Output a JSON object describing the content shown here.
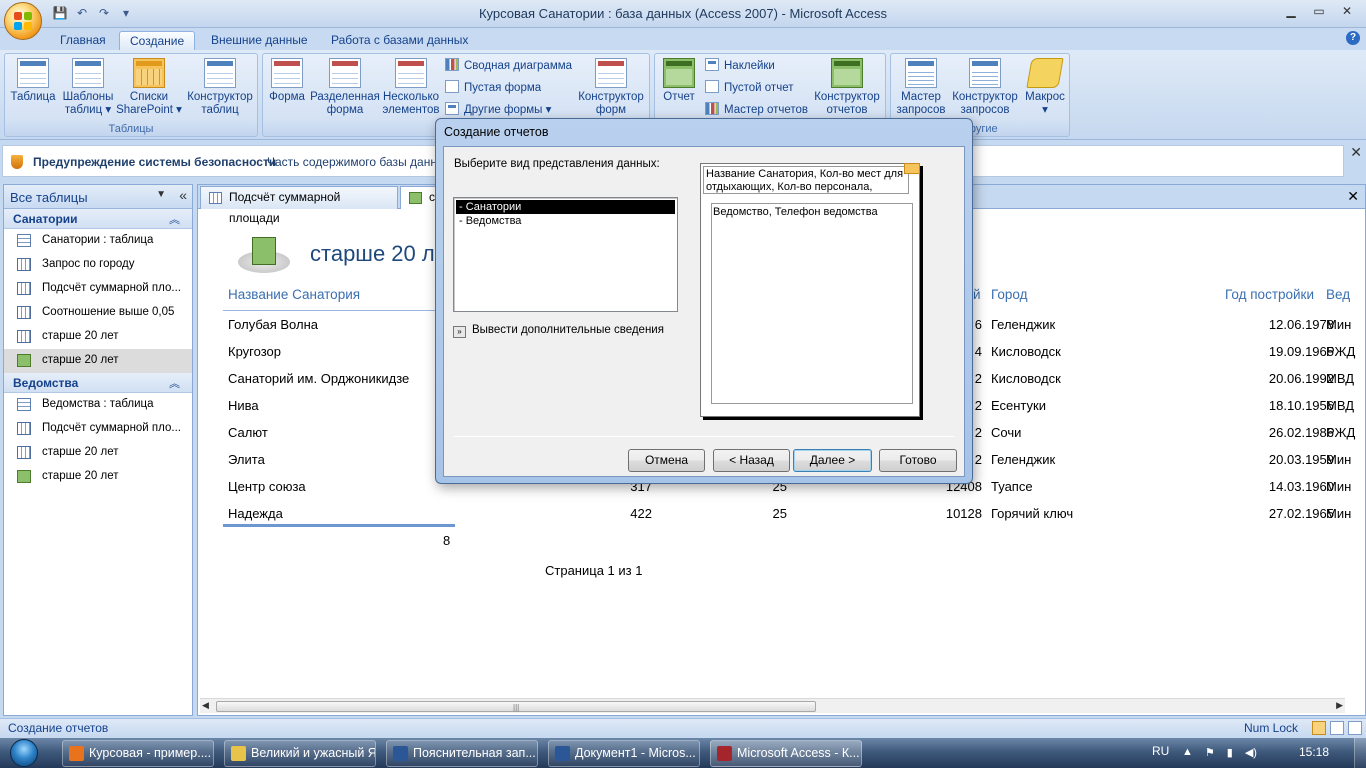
{
  "window": {
    "title": "Курсовая Санатории : база данных (Access 2007) - Microsoft Access",
    "controls": [
      "▁",
      "▭",
      "✕"
    ]
  },
  "ribbon_tabs": [
    "Главная",
    "Создание",
    "Внешние данные",
    "Работа с базами данных"
  ],
  "active_tab": "Создание",
  "ribbon": {
    "tables": {
      "label": "Таблицы",
      "table": "Таблица",
      "templates": "Шаблоны\nтаблиц ▾",
      "sharepoint": "Списки\nSharePoint ▾",
      "designer": "Конструктор\nтаблиц"
    },
    "forms": {
      "form": "Форма",
      "split": "Разделенная\nформа",
      "multiple": "Несколько\nэлементов",
      "pivot_chart": "Сводная диаграмма",
      "blank_form": "Пустая форма",
      "other_forms": "Другие формы ▾",
      "designer": "Конструктор\nформ"
    },
    "reports": {
      "report": "Отчет",
      "labels": "Наклейки",
      "blank_report": "Пустой отчет",
      "wizard": "Мастер отчетов",
      "designer": "Конструктор\nотчетов"
    },
    "other": {
      "label": "Другие",
      "query_wizard": "Мастер\nзапросов",
      "query_designer": "Конструктор\nзапросов",
      "macro": "Макрос\n▾"
    }
  },
  "security": {
    "title": "Предупреждение системы безопасности",
    "message": "Часть содержимого базы данн"
  },
  "nav": {
    "header": "Все таблицы",
    "groups": [
      {
        "name": "Санатории",
        "items": [
          {
            "label": "Санатории : таблица",
            "type": "table"
          },
          {
            "label": "Запрос по городу",
            "type": "query"
          },
          {
            "label": "Подсчёт суммарной пло...",
            "type": "query"
          },
          {
            "label": "Соотношение выше 0,05",
            "type": "query"
          },
          {
            "label": "старше 20 лет",
            "type": "query"
          },
          {
            "label": "старше 20 лет",
            "type": "report",
            "selected": true
          }
        ]
      },
      {
        "name": "Ведомства",
        "items": [
          {
            "label": "Ведомства : таблица",
            "type": "table"
          },
          {
            "label": "Подсчёт суммарной пло...",
            "type": "query"
          },
          {
            "label": "старше 20 лет",
            "type": "query"
          },
          {
            "label": "старше 20 лет",
            "type": "report"
          }
        ]
      }
    ]
  },
  "doc_tabs": [
    "Подсчёт суммарной площади",
    "ст"
  ],
  "report": {
    "title": "старше 20 л",
    "headers": {
      "name": "Название Санатория",
      "col_hidden": "й",
      "city": "Город",
      "year": "Год постройки",
      "dept": "Вед"
    },
    "rows": [
      {
        "name": "Голубая Волна",
        "c1": "",
        "c2": "",
        "c3": "6",
        "city": "Геленджик",
        "date": "12.06.1978",
        "dept": "Мин"
      },
      {
        "name": "Кругозор",
        "c1": "",
        "c2": "",
        "c3": "4",
        "city": "Кисловодск",
        "date": "19.09.1965",
        "dept": "РЖД"
      },
      {
        "name": "Санаторий им. Орджоникидзе",
        "c1": "",
        "c2": "",
        "c3": "2",
        "city": "Кисловодск",
        "date": "20.06.1992",
        "dept": "МВД"
      },
      {
        "name": "Нива",
        "c1": "",
        "c2": "",
        "c3": "2",
        "city": "Есентуки",
        "date": "18.10.1956",
        "dept": "МВД"
      },
      {
        "name": "Салют",
        "c1": "",
        "c2": "",
        "c3": "2",
        "city": "Сочи",
        "date": "26.02.1986",
        "dept": "РЖД"
      },
      {
        "name": "Элита",
        "c1": "",
        "c2": "",
        "c3": "2",
        "city": "Геленджик",
        "date": "20.03.1959",
        "dept": "Мин"
      },
      {
        "name": "Центр союза",
        "c1": "317",
        "c2": "25",
        "c3": "12408",
        "city": "Туапсе",
        "date": "14.03.1960",
        "dept": "Мин"
      },
      {
        "name": "Надежда",
        "c1": "422",
        "c2": "25",
        "c3": "10128",
        "city": "Горячий ключ",
        "date": "27.02.1965",
        "dept": "Мин"
      }
    ],
    "count": "8",
    "page": "Страница 1 из 1"
  },
  "dialog": {
    "title": "Создание отчетов",
    "prompt": "Выберите вид представления данных:",
    "options": [
      "- Санатории",
      "- Ведомства"
    ],
    "selected_option": "- Санатории",
    "more_info": "Вывести дополнительные сведения",
    "preview_header": "Название Санатория, Кол-во мест для отдыхающих, Кол-во персонала,",
    "preview_body": "Ведомство, Телефон ведомства",
    "buttons": {
      "cancel": "Отмена",
      "back": "< Назад",
      "next": "Далее >",
      "finish": "Готово"
    }
  },
  "status": {
    "text": "Создание отчетов",
    "numlock": "Num Lock"
  },
  "taskbar": {
    "items": [
      {
        "label": "Курсовая - пример....",
        "color": "#e8731c"
      },
      {
        "label": "Великий и ужасный Я",
        "color": "#e8c34a"
      },
      {
        "label": "Пояснительная зап...",
        "color": "#2b5797"
      },
      {
        "label": "Документ1 - Micros...",
        "color": "#2b5797"
      },
      {
        "label": "Microsoft Access - К...",
        "color": "#a4262c",
        "active": true
      }
    ],
    "lang": "RU",
    "time": "15:18"
  },
  "colors": {
    "accent": "#15428b",
    "report_header": "#3a6fb0",
    "report_title": "#1f497d"
  }
}
